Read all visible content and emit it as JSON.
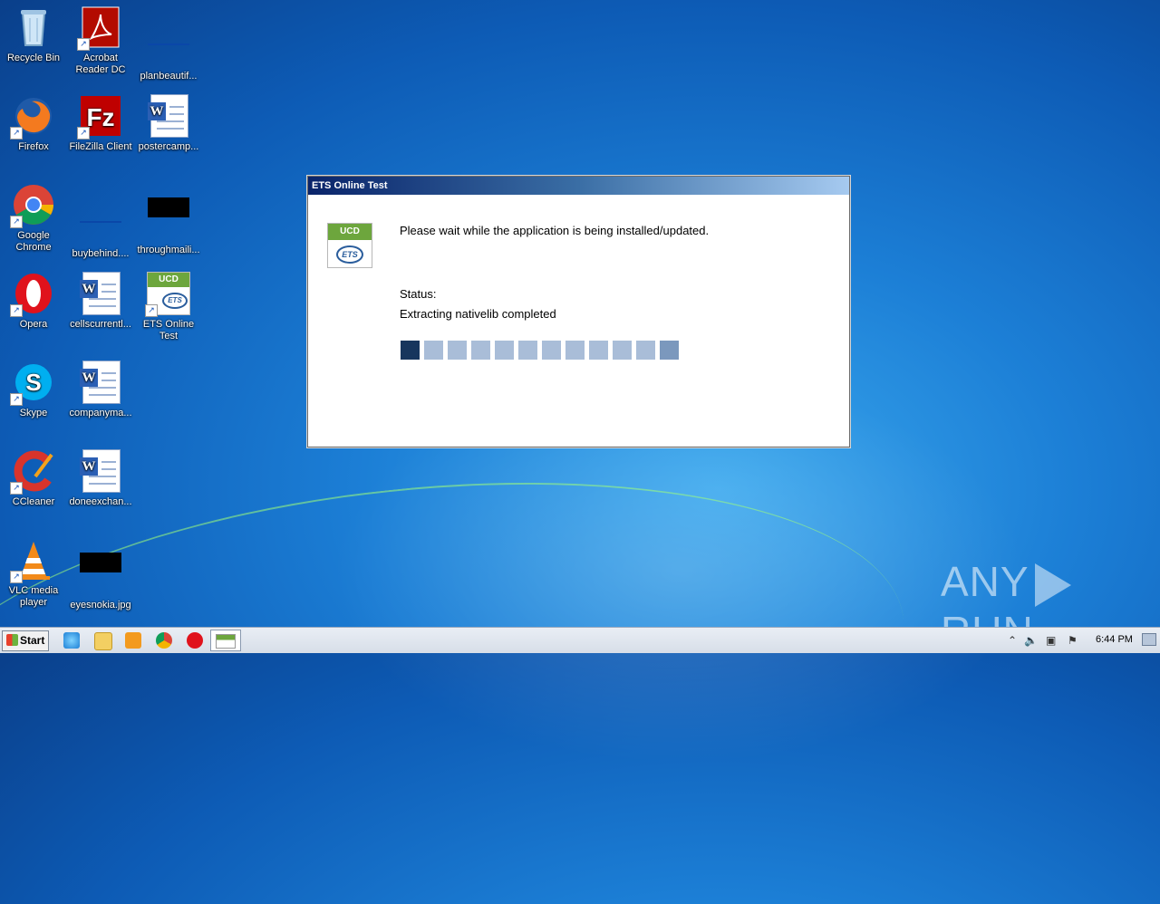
{
  "desktop": {
    "icons": [
      {
        "label": "Recycle Bin",
        "icon": "recycle-bin-icon"
      },
      {
        "label": "Acrobat Reader DC",
        "icon": "acrobat-icon"
      },
      {
        "label": "planbeautif...",
        "icon": "file-icon"
      },
      {
        "label": "Firefox",
        "icon": "firefox-icon"
      },
      {
        "label": "FileZilla Client",
        "icon": "filezilla-icon"
      },
      {
        "label": "postercamp...",
        "icon": "word-doc-icon"
      },
      {
        "label": "Google Chrome",
        "icon": "chrome-icon"
      },
      {
        "label": "buybehind....",
        "icon": "file-icon"
      },
      {
        "label": "throughmaili...",
        "icon": "image-file-icon"
      },
      {
        "label": "Opera",
        "icon": "opera-icon"
      },
      {
        "label": "cellscurrentl...",
        "icon": "word-doc-icon"
      },
      {
        "label": "ETS Online Test",
        "icon": "ets-icon"
      },
      {
        "label": "Skype",
        "icon": "skype-icon"
      },
      {
        "label": "companyma...",
        "icon": "word-doc-icon"
      },
      {
        "label": "CCleaner",
        "icon": "ccleaner-icon"
      },
      {
        "label": "doneexchan...",
        "icon": "word-doc-icon"
      },
      {
        "label": "VLC media player",
        "icon": "vlc-icon"
      },
      {
        "label": "eyesnokia.jpg",
        "icon": "image-file-icon"
      }
    ]
  },
  "dialog": {
    "title": "ETS Online Test",
    "logo_top": "UCD",
    "logo_bottom": "ETS",
    "message": "Please wait while the application is being installed/updated.",
    "status_label": "Status:",
    "status_text": "Extracting nativelib completed",
    "progress": {
      "total_segments": 12,
      "completed_segments": 1
    }
  },
  "watermark": {
    "left": "ANY",
    "right": "RUN"
  },
  "taskbar": {
    "start_label": "Start",
    "clock": "6:44 PM",
    "pinned": [
      "ie-icon",
      "explorer-icon",
      "media-player-icon",
      "chrome-icon",
      "opera-icon",
      "ets-app-icon"
    ]
  },
  "colors": {
    "titlebar_dark": "#0a246a",
    "progress_done": "#17365d",
    "progress_pending": "#a9bdd8",
    "ucd_green": "#6da63d"
  }
}
